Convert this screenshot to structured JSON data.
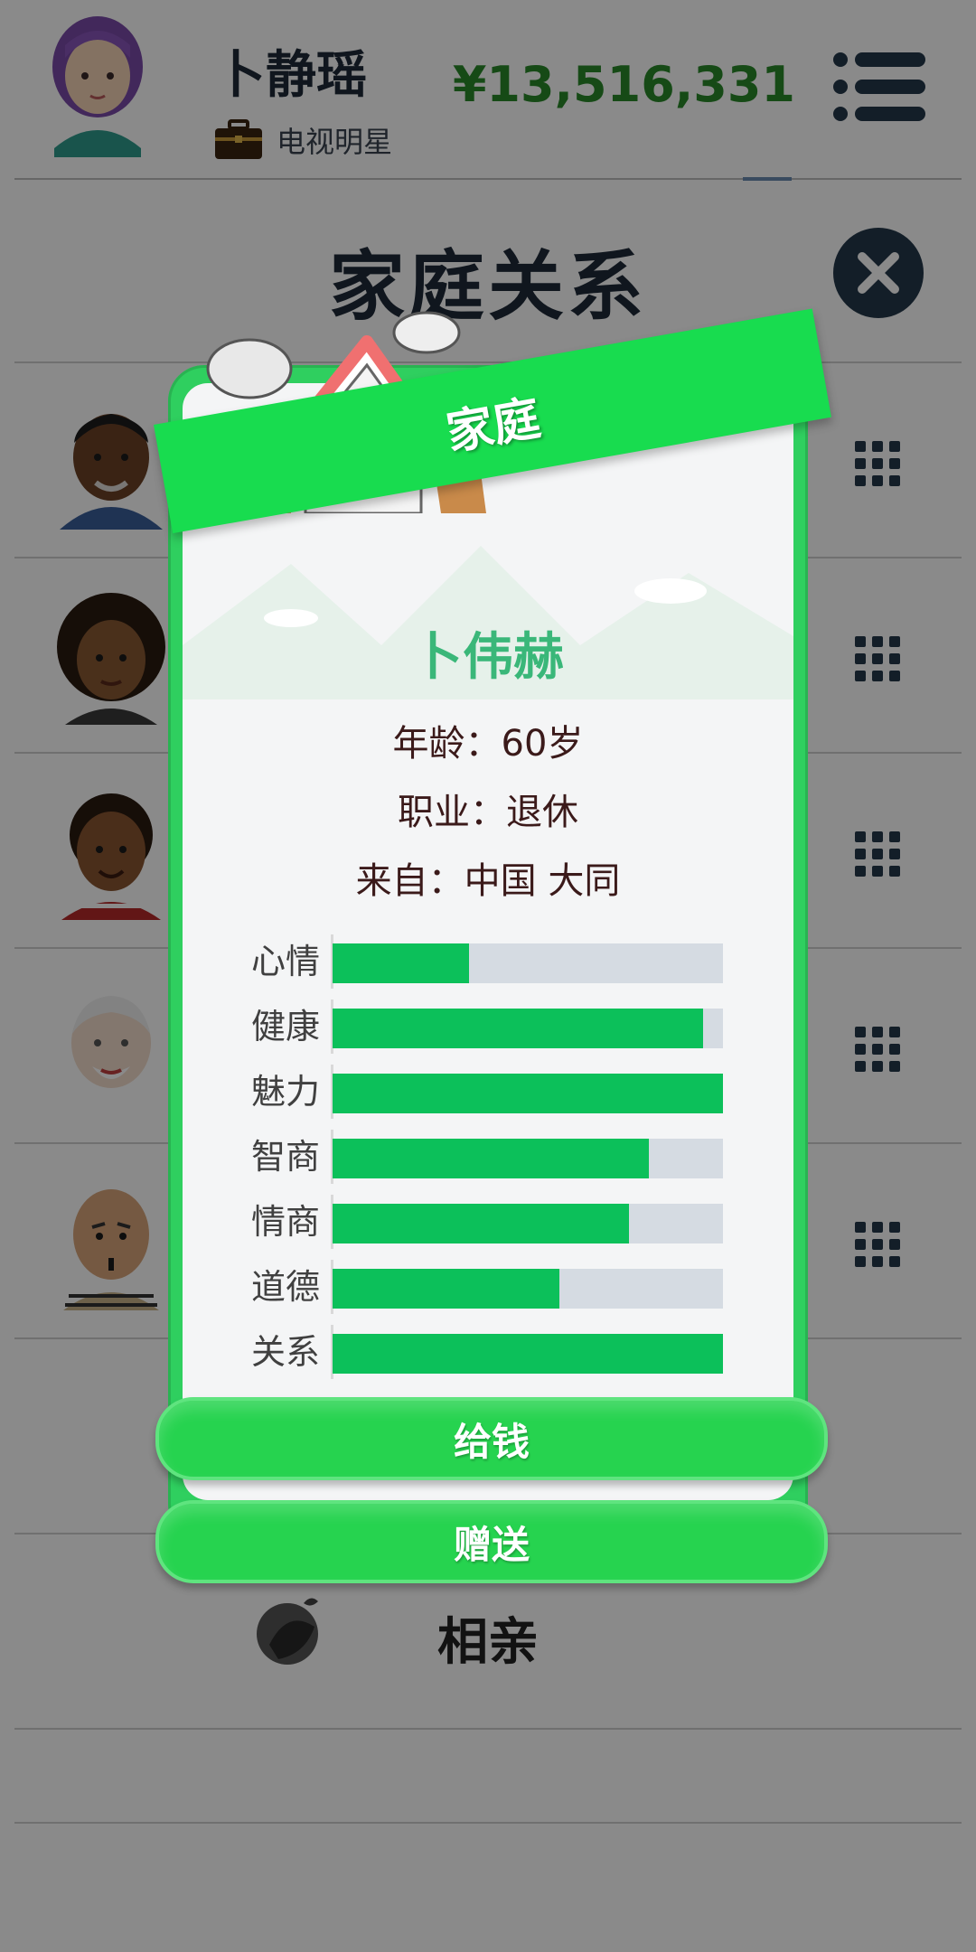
{
  "header": {
    "player_name": "卜静瑶",
    "job": "电视明星",
    "money": "¥13,516,331"
  },
  "page": {
    "title": "家庭关系"
  },
  "family_rows": [
    {
      "avatar": "elder-man-avatar"
    },
    {
      "avatar": "curly-woman-avatar"
    },
    {
      "avatar": "young-man-avatar"
    },
    {
      "avatar": "grandpa-avatar"
    },
    {
      "avatar": "bald-man-avatar"
    }
  ],
  "dating": {
    "label": "相亲"
  },
  "modal": {
    "banner": "家庭",
    "name": "卜伟赫",
    "age_line": "年龄：60岁",
    "job_line": "职业：退休",
    "origin_line": "来自：中国 大同",
    "stats": [
      {
        "label": "心情",
        "value": 0.35
      },
      {
        "label": "健康",
        "value": 0.95
      },
      {
        "label": "魅力",
        "value": 1.0
      },
      {
        "label": "智商",
        "value": 0.81
      },
      {
        "label": "情商",
        "value": 0.76
      },
      {
        "label": "道德",
        "value": 0.58
      },
      {
        "label": "关系",
        "value": 1.0
      }
    ],
    "buttons": {
      "give_money": "给钱",
      "gift": "赠送"
    }
  },
  "colors": {
    "money": "#2a8a2a",
    "accent_green": "#18dc4f",
    "bar_fill": "#0cc05a",
    "bar_track": "#d5dbe2",
    "name_green": "#3ab779",
    "close_button": "#24384a"
  }
}
